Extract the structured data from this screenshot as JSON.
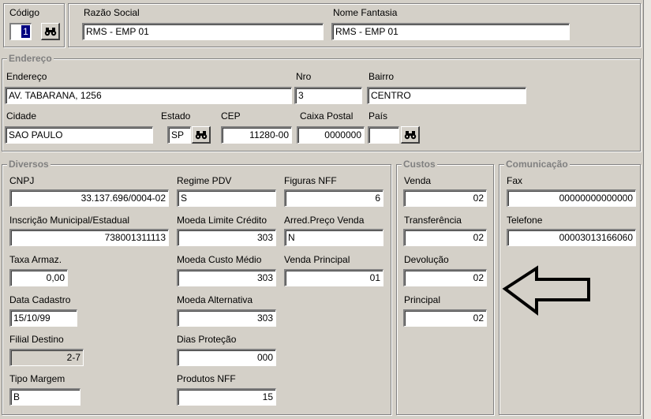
{
  "header": {
    "codigo_label": "Código",
    "codigo_value": "1",
    "razao_label": "Razão Social",
    "razao_value": "RMS - EMP 01",
    "fantasia_label": "Nome Fantasia",
    "fantasia_value": "RMS - EMP 01"
  },
  "endereco": {
    "legend": "Endereço",
    "endereco_label": "Endereço",
    "endereco_value": "AV.  TABARANA, 1256",
    "nro_label": "Nro",
    "nro_value": "3",
    "bairro_label": "Bairro",
    "bairro_value": "CENTRO",
    "cidade_label": "Cidade",
    "cidade_value": "SAO PAULO",
    "estado_label": "Estado",
    "estado_value": "SP",
    "cep_label": "CEP",
    "cep_value": "11280-00",
    "caixa_label": "Caixa Postal",
    "caixa_value": "0000000",
    "pais_label": "País",
    "pais_value": ""
  },
  "diversos": {
    "legend": "Diversos",
    "cnpj_label": "CNPJ",
    "cnpj_value": "33.137.696/0004-02",
    "inscricao_label": "Inscrição Municipal/Estadual",
    "inscricao_value": "738001311113",
    "taxa_label": "Taxa Armaz.",
    "taxa_value": "0,00",
    "data_label": "Data Cadastro",
    "data_value": "15/10/99",
    "filial_label": "Filial Destino",
    "filial_value": "2-7",
    "tipo_label": "Tipo Margem",
    "tipo_value": "B",
    "regime_label": "Regime PDV",
    "regime_value": "S",
    "moeda_limite_label": "Moeda Limite Crédito",
    "moeda_limite_value": "303",
    "moeda_custo_label": "Moeda Custo Médio",
    "moeda_custo_value": "303",
    "moeda_alt_label": "Moeda Alternativa",
    "moeda_alt_value": "303",
    "dias_label": "Dias Proteção",
    "dias_value": "000",
    "produtos_label": "Produtos NFF",
    "produtos_value": "15",
    "figuras_label": "Figuras NFF",
    "figuras_value": "6",
    "arred_label": "Arred.Preço Venda",
    "arred_value": "N",
    "venda_principal_label": "Venda Principal",
    "venda_principal_value": "01"
  },
  "custos": {
    "legend": "Custos",
    "venda_label": "Venda",
    "venda_value": "02",
    "transf_label": "Transferência",
    "transf_value": "02",
    "devol_label": "Devolução",
    "devol_value": "02",
    "principal_label": "Principal",
    "principal_value": "02"
  },
  "comunicacao": {
    "legend": "Comunicação",
    "fax_label": "Fax",
    "fax_value": "00000000000000",
    "telefone_label": "Telefone",
    "telefone_value": "00003013166060"
  },
  "icons": {
    "search": "binoculars-icon",
    "annotation": "arrow-left-outline-icon"
  }
}
